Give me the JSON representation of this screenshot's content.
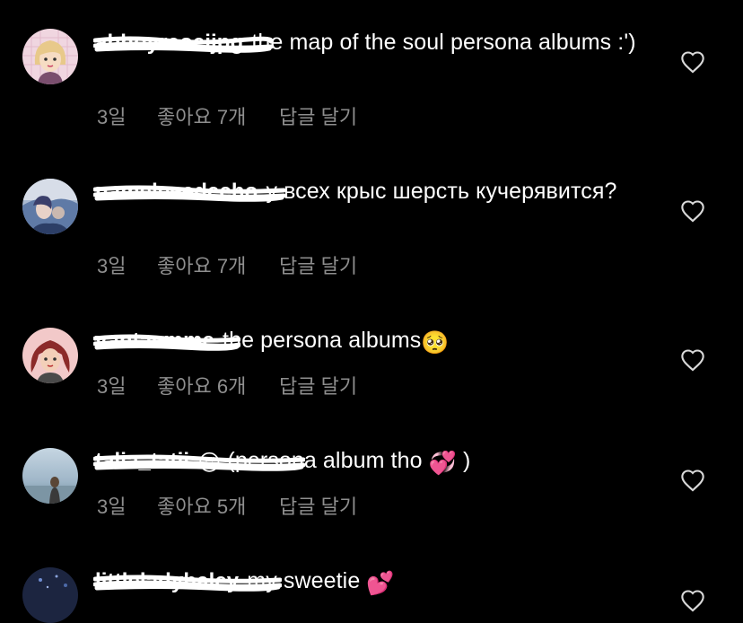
{
  "comments": [
    {
      "username": "abhoyreoeijpg",
      "text": "the map of the soul persona albums :')",
      "time": "3일",
      "likes": "좋아요 7개",
      "reply": "답글 달기",
      "avatar_icon": "avatar-cartoon-blonde",
      "avatar_bg": "#f0d6e0"
    },
    {
      "username": "nameleeedecho",
      "text": "у всех крыс шерсть кучерявится?",
      "time": "3일",
      "likes": "좋아요 7개",
      "reply": "답글 달기",
      "avatar_icon": "avatar-photo-blue",
      "avatar_bg": "#a9b9d0"
    },
    {
      "username": "vantaemme",
      "text": "the persona albums",
      "emoji": "🥺",
      "time": "3일",
      "likes": "좋아요 6개",
      "reply": "답글 달기",
      "avatar_icon": "avatar-cartoon-redhair",
      "avatar_bg": "#f2c9c9"
    },
    {
      "username": "talia_tatii",
      "text_before_emoji": "",
      "emoji_lead": "😍",
      "text": "(persona album tho",
      "emoji": "💞",
      "text_after": ")",
      "time": "3일",
      "likes": "좋아요 5개",
      "reply": "답글 달기",
      "avatar_icon": "avatar-photo-sky",
      "avatar_bg": "#9fb6c8"
    },
    {
      "username": "littleladyhaley",
      "text": "my sweetie",
      "emoji": "💕",
      "avatar_icon": "avatar-photo-dark",
      "avatar_bg": "#1c2540"
    }
  ],
  "icons": {
    "like": "heart-outline-icon"
  },
  "colors": {
    "background": "#000000",
    "text": "#ffffff",
    "meta": "#8e8e8e"
  }
}
